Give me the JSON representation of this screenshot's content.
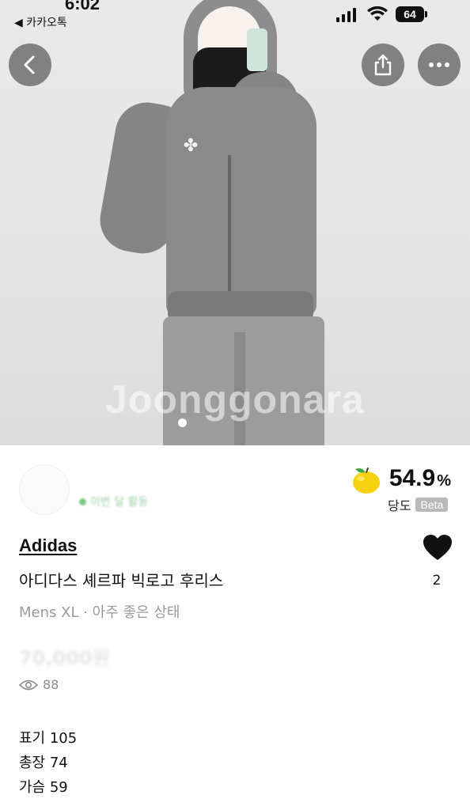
{
  "status_bar": {
    "time": "6:02",
    "back_app": "◀ 카카오톡",
    "battery": "64"
  },
  "hero": {
    "watermark": "Joonggonara",
    "page_indicator": {
      "current": 1
    }
  },
  "nav": {
    "back_icon": "chevron-left-icon",
    "share_icon": "share-icon",
    "more_icon": "more-horizontal-icon"
  },
  "seller": {
    "name": "",
    "status": "이번 달 활동"
  },
  "sweetness": {
    "value": "54.9",
    "unit": "%",
    "label": "당도",
    "badge": "Beta"
  },
  "product": {
    "brand": "Adidas",
    "title": "아디다스 셰르파 빅로고 후리스",
    "meta": "Mens XL · 아주 좋은 상태",
    "price": "70,000원",
    "views": "88",
    "likes": "2",
    "description": [
      "표기 105",
      "총장 74",
      "가슴 59"
    ]
  },
  "colors": {
    "accent_green": "#7cc48a",
    "apple_yellow": "#f5d210",
    "text_primary": "#111111",
    "text_secondary": "#9a9a9a"
  }
}
